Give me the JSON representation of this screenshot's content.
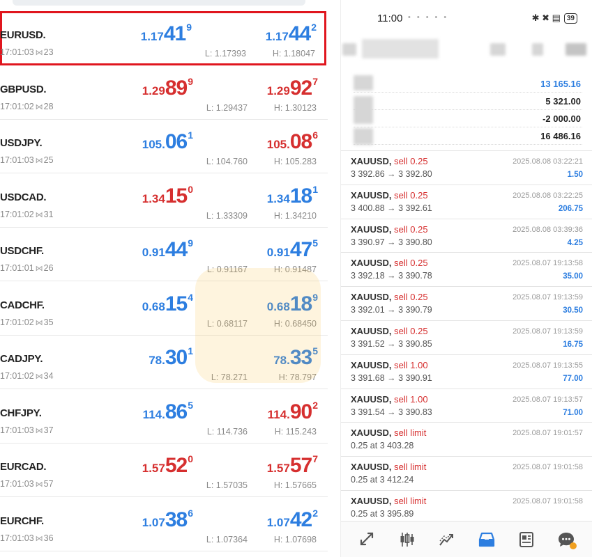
{
  "quotes": [
    {
      "symbol": "EURUSD.",
      "time": "17:01:03",
      "spread": "23",
      "bid_small": "1.17",
      "bid_big": "41",
      "bid_sup": "9",
      "bid_color": "blue",
      "ask_small": "1.17",
      "ask_big": "44",
      "ask_sup": "2",
      "ask_color": "blue",
      "low": "L: 1.17393",
      "high": "H: 1.18047"
    },
    {
      "symbol": "GBPUSD.",
      "time": "17:01:02",
      "spread": "28",
      "bid_small": "1.29",
      "bid_big": "89",
      "bid_sup": "9",
      "bid_color": "red",
      "ask_small": "1.29",
      "ask_big": "92",
      "ask_sup": "7",
      "ask_color": "red",
      "low": "L: 1.29437",
      "high": "H: 1.30123"
    },
    {
      "symbol": "USDJPY.",
      "time": "17:01:03",
      "spread": "25",
      "bid_small": "105.",
      "bid_big": "06",
      "bid_sup": "1",
      "bid_color": "blue",
      "ask_small": "105.",
      "ask_big": "08",
      "ask_sup": "6",
      "ask_color": "red",
      "low": "L: 104.760",
      "high": "H: 105.283"
    },
    {
      "symbol": "USDCAD.",
      "time": "17:01:02",
      "spread": "31",
      "bid_small": "1.34",
      "bid_big": "15",
      "bid_sup": "0",
      "bid_color": "red",
      "ask_small": "1.34",
      "ask_big": "18",
      "ask_sup": "1",
      "ask_color": "blue",
      "low": "L: 1.33309",
      "high": "H: 1.34210"
    },
    {
      "symbol": "USDCHF.",
      "time": "17:01:01",
      "spread": "26",
      "bid_small": "0.91",
      "bid_big": "44",
      "bid_sup": "9",
      "bid_color": "blue",
      "ask_small": "0.91",
      "ask_big": "47",
      "ask_sup": "5",
      "ask_color": "blue",
      "low": "L: 0.91167",
      "high": "H: 0.91487"
    },
    {
      "symbol": "CADCHF.",
      "time": "17:01:02",
      "spread": "35",
      "bid_small": "0.68",
      "bid_big": "15",
      "bid_sup": "4",
      "bid_color": "blue",
      "ask_small": "0.68",
      "ask_big": "18",
      "ask_sup": "9",
      "ask_color": "blue",
      "low": "L: 0.68117",
      "high": "H: 0.68450"
    },
    {
      "symbol": "CADJPY.",
      "time": "17:01:02",
      "spread": "34",
      "bid_small": "78.",
      "bid_big": "30",
      "bid_sup": "1",
      "bid_color": "blue",
      "ask_small": "78.",
      "ask_big": "33",
      "ask_sup": "5",
      "ask_color": "blue",
      "low": "L: 78.271",
      "high": "H: 78.797"
    },
    {
      "symbol": "CHFJPY.",
      "time": "17:01:03",
      "spread": "37",
      "bid_small": "114.",
      "bid_big": "86",
      "bid_sup": "5",
      "bid_color": "blue",
      "ask_small": "114.",
      "ask_big": "90",
      "ask_sup": "2",
      "ask_color": "red",
      "low": "L: 114.736",
      "high": "H: 115.243"
    },
    {
      "symbol": "EURCAD.",
      "time": "17:01:03",
      "spread": "57",
      "bid_small": "1.57",
      "bid_big": "52",
      "bid_sup": "0",
      "bid_color": "red",
      "ask_small": "1.57",
      "ask_big": "57",
      "ask_sup": "7",
      "ask_color": "red",
      "low": "L: 1.57035",
      "high": "H: 1.57665"
    },
    {
      "symbol": "EURCHF.",
      "time": "17:01:03",
      "spread": "36",
      "bid_small": "1.07",
      "bid_big": "38",
      "bid_sup": "6",
      "bid_color": "blue",
      "ask_small": "1.07",
      "ask_big": "42",
      "ask_sup": "2",
      "ask_color": "blue",
      "low": "L: 1.07364",
      "high": "H: 1.07698"
    }
  ],
  "status": {
    "time": "11:00",
    "battery": "39",
    "icons": "✱ ✖ ▤"
  },
  "balance": [
    {
      "value": "13 165.16",
      "color": "blue"
    },
    {
      "value": "5 321.00",
      "color": "dark"
    },
    {
      "value": "-2 000.00",
      "color": "dark"
    },
    {
      "value": "16 486.16",
      "color": "dark"
    }
  ],
  "trades": [
    {
      "symbol": "XAUUSD,",
      "side": "sell 0.25",
      "prices": "3 392.86 → 3 392.80",
      "time": "2025.08.08 03:22:21",
      "profit": "1.50"
    },
    {
      "symbol": "XAUUSD,",
      "side": "sell 0.25",
      "prices": "3 400.88 → 3 392.61",
      "time": "2025.08.08 03:22:25",
      "profit": "206.75"
    },
    {
      "symbol": "XAUUSD,",
      "side": "sell 0.25",
      "prices": "3 390.97 → 3 390.80",
      "time": "2025.08.08 03:39:36",
      "profit": "4.25"
    },
    {
      "symbol": "XAUUSD,",
      "side": "sell 0.25",
      "prices": "3 392.18 → 3 390.78",
      "time": "2025.08.07 19:13:58",
      "profit": "35.00"
    },
    {
      "symbol": "XAUUSD,",
      "side": "sell 0.25",
      "prices": "3 392.01 → 3 390.79",
      "time": "2025.08.07 19:13:59",
      "profit": "30.50"
    },
    {
      "symbol": "XAUUSD,",
      "side": "sell 0.25",
      "prices": "3 391.52 → 3 390.85",
      "time": "2025.08.07 19:13:59",
      "profit": "16.75"
    },
    {
      "symbol": "XAUUSD,",
      "side": "sell 1.00",
      "prices": "3 391.68 → 3 390.91",
      "time": "2025.08.07 19:13:55",
      "profit": "77.00"
    },
    {
      "symbol": "XAUUSD,",
      "side": "sell 1.00",
      "prices": "3 391.54 → 3 390.83",
      "time": "2025.08.07 19:13:57",
      "profit": "71.00"
    },
    {
      "symbol": "XAUUSD,",
      "side": "sell limit",
      "prices": "0.25 at 3 403.28",
      "time": "2025.08.07 19:01:57",
      "profit": ""
    },
    {
      "symbol": "XAUUSD,",
      "side": "sell limit",
      "prices": "0.25 at 3 412.24",
      "time": "2025.08.07 19:01:58",
      "profit": ""
    },
    {
      "symbol": "XAUUSD,",
      "side": "sell limit",
      "prices": "0.25 at 3 395.89",
      "time": "2025.08.07 19:01:58",
      "profit": ""
    }
  ],
  "nav": [
    {
      "icon": "quotes-icon"
    },
    {
      "icon": "chart-icon"
    },
    {
      "icon": "trade-icon"
    },
    {
      "icon": "history-icon",
      "active": true
    },
    {
      "icon": "news-icon"
    },
    {
      "icon": "messages-icon"
    }
  ],
  "colors": {
    "blue": "#2d7ee0",
    "red": "#d62f2f",
    "highlight": "#e0161e",
    "active_nav": "#2d7ee0",
    "nav_inactive": "#555555"
  }
}
